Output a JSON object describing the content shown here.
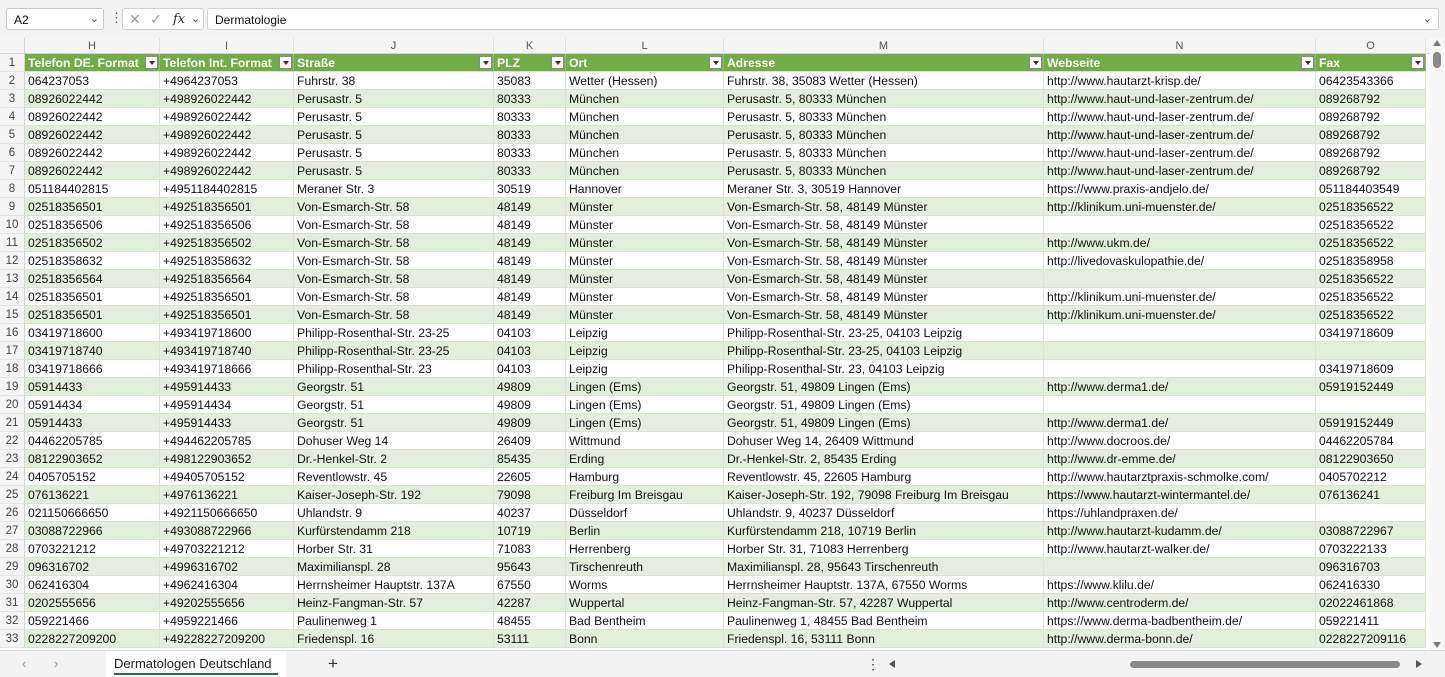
{
  "formula_bar": {
    "name_box": "A2",
    "more_glyph": "⋮",
    "cancel_glyph": "✕",
    "enter_glyph": "✓",
    "fx_glyph": "fx",
    "chevron_glyph": "⌄",
    "content": "Dermatologie"
  },
  "columns": [
    "H",
    "I",
    "J",
    "K",
    "L",
    "M",
    "N",
    "O"
  ],
  "header_row": {
    "number": "1",
    "cells": [
      "Telefon DE. Format",
      "Telefon Int. Format",
      "Straße",
      "PLZ",
      "Ort",
      "Adresse",
      "Webseite",
      "Fax"
    ]
  },
  "rows": [
    {
      "n": "2",
      "cells": [
        "064237053",
        "+4964237053",
        "Fuhrstr. 38",
        "35083",
        "Wetter (Hessen)",
        "Fuhrstr. 38, 35083 Wetter (Hessen)",
        "http://www.hautarzt-krisp.de/",
        "06423543366"
      ]
    },
    {
      "n": "3",
      "cells": [
        "08926022442",
        "+498926022442",
        "Perusastr. 5",
        "80333",
        "München",
        "Perusastr. 5, 80333 München",
        "http://www.haut-und-laser-zentrum.de/",
        "089268792"
      ]
    },
    {
      "n": "4",
      "cells": [
        "08926022442",
        "+498926022442",
        "Perusastr. 5",
        "80333",
        "München",
        "Perusastr. 5, 80333 München",
        "http://www.haut-und-laser-zentrum.de/",
        "089268792"
      ]
    },
    {
      "n": "5",
      "cells": [
        "08926022442",
        "+498926022442",
        "Perusastr. 5",
        "80333",
        "München",
        "Perusastr. 5, 80333 München",
        "http://www.haut-und-laser-zentrum.de/",
        "089268792"
      ]
    },
    {
      "n": "6",
      "cells": [
        "08926022442",
        "+498926022442",
        "Perusastr. 5",
        "80333",
        "München",
        "Perusastr. 5, 80333 München",
        "http://www.haut-und-laser-zentrum.de/",
        "089268792"
      ]
    },
    {
      "n": "7",
      "cells": [
        "08926022442",
        "+498926022442",
        "Perusastr. 5",
        "80333",
        "München",
        "Perusastr. 5, 80333 München",
        "http://www.haut-und-laser-zentrum.de/",
        "089268792"
      ]
    },
    {
      "n": "8",
      "cells": [
        "051184402815",
        "+4951184402815",
        "Meraner Str. 3",
        "30519",
        "Hannover",
        "Meraner Str. 3, 30519 Hannover",
        "https://www.praxis-andjelo.de/",
        "051184403549"
      ]
    },
    {
      "n": "9",
      "cells": [
        "02518356501",
        "+492518356501",
        "Von-Esmarch-Str. 58",
        "48149",
        "Münster",
        "Von-Esmarch-Str. 58, 48149 Münster",
        "http://klinikum.uni-muenster.de/",
        "02518356522"
      ]
    },
    {
      "n": "10",
      "cells": [
        "02518356506",
        "+492518356506",
        "Von-Esmarch-Str. 58",
        "48149",
        "Münster",
        "Von-Esmarch-Str. 58, 48149 Münster",
        "",
        "02518356522"
      ]
    },
    {
      "n": "11",
      "cells": [
        "02518356502",
        "+492518356502",
        "Von-Esmarch-Str. 58",
        "48149",
        "Münster",
        "Von-Esmarch-Str. 58, 48149 Münster",
        "http://www.ukm.de/",
        "02518356522"
      ]
    },
    {
      "n": "12",
      "cells": [
        "02518358632",
        "+492518358632",
        "Von-Esmarch-Str. 58",
        "48149",
        "Münster",
        "Von-Esmarch-Str. 58, 48149 Münster",
        "http://livedovaskulopathie.de/",
        "02518358958"
      ]
    },
    {
      "n": "13",
      "cells": [
        "02518356564",
        "+492518356564",
        "Von-Esmarch-Str. 58",
        "48149",
        "Münster",
        "Von-Esmarch-Str. 58, 48149 Münster",
        "",
        "02518356522"
      ]
    },
    {
      "n": "14",
      "cells": [
        "02518356501",
        "+492518356501",
        "Von-Esmarch-Str. 58",
        "48149",
        "Münster",
        "Von-Esmarch-Str. 58, 48149 Münster",
        "http://klinikum.uni-muenster.de/",
        "02518356522"
      ]
    },
    {
      "n": "15",
      "cells": [
        "02518356501",
        "+492518356501",
        "Von-Esmarch-Str. 58",
        "48149",
        "Münster",
        "Von-Esmarch-Str. 58, 48149 Münster",
        "http://klinikum.uni-muenster.de/",
        "02518356522"
      ]
    },
    {
      "n": "16",
      "cells": [
        "03419718600",
        "+493419718600",
        "Philipp-Rosenthal-Str. 23-25",
        "04103",
        "Leipzig",
        "Philipp-Rosenthal-Str. 23-25, 04103 Leipzig",
        "",
        "03419718609"
      ]
    },
    {
      "n": "17",
      "cells": [
        "03419718740",
        "+493419718740",
        "Philipp-Rosenthal-Str. 23-25",
        "04103",
        "Leipzig",
        "Philipp-Rosenthal-Str. 23-25, 04103 Leipzig",
        "",
        ""
      ]
    },
    {
      "n": "18",
      "cells": [
        "03419718666",
        "+493419718666",
        "Philipp-Rosenthal-Str. 23",
        "04103",
        "Leipzig",
        "Philipp-Rosenthal-Str. 23, 04103 Leipzig",
        "",
        "03419718609"
      ]
    },
    {
      "n": "19",
      "cells": [
        "05914433",
        "+495914433",
        "Georgstr. 51",
        "49809",
        "Lingen (Ems)",
        "Georgstr. 51, 49809 Lingen (Ems)",
        "http://www.derma1.de/",
        "05919152449"
      ]
    },
    {
      "n": "20",
      "cells": [
        "05914434",
        "+495914434",
        "Georgstr. 51",
        "49809",
        "Lingen (Ems)",
        "Georgstr. 51, 49809 Lingen (Ems)",
        "",
        ""
      ]
    },
    {
      "n": "21",
      "cells": [
        "05914433",
        "+495914433",
        "Georgstr. 51",
        "49809",
        "Lingen (Ems)",
        "Georgstr. 51, 49809 Lingen (Ems)",
        "http://www.derma1.de/",
        "05919152449"
      ]
    },
    {
      "n": "22",
      "cells": [
        "04462205785",
        "+494462205785",
        "Dohuser Weg 14",
        "26409",
        "Wittmund",
        "Dohuser Weg 14, 26409 Wittmund",
        "http://www.docroos.de/",
        "04462205784"
      ]
    },
    {
      "n": "23",
      "cells": [
        "08122903652",
        "+498122903652",
        "Dr.-Henkel-Str. 2",
        "85435",
        "Erding",
        "Dr.-Henkel-Str. 2, 85435 Erding",
        "http://www.dr-emme.de/",
        "08122903650"
      ]
    },
    {
      "n": "24",
      "cells": [
        "0405705152",
        "+49405705152",
        "Reventlowstr. 45",
        "22605",
        "Hamburg",
        "Reventlowstr. 45, 22605 Hamburg",
        "http://www.hautarztpraxis-schmolke.com/",
        "0405702212"
      ]
    },
    {
      "n": "25",
      "cells": [
        "076136221",
        "+4976136221",
        "Kaiser-Joseph-Str. 192",
        "79098",
        "Freiburg Im Breisgau",
        "Kaiser-Joseph-Str. 192, 79098 Freiburg Im Breisgau",
        "https://www.hautarzt-wintermantel.de/",
        "076136241"
      ]
    },
    {
      "n": "26",
      "cells": [
        "021150666650",
        "+4921150666650",
        "Uhlandstr. 9",
        "40237",
        "Düsseldorf",
        "Uhlandstr. 9, 40237 Düsseldorf",
        "https://uhlandpraxen.de/",
        ""
      ]
    },
    {
      "n": "27",
      "cells": [
        "03088722966",
        "+493088722966",
        "Kurfürstendamm 218",
        "10719",
        "Berlin",
        "Kurfürstendamm 218, 10719 Berlin",
        "http://www.hautarzt-kudamm.de/",
        "03088722967"
      ]
    },
    {
      "n": "28",
      "cells": [
        "0703221212",
        "+49703221212",
        "Horber Str. 31",
        "71083",
        "Herrenberg",
        "Horber Str. 31, 71083 Herrenberg",
        "http://www.hautarzt-walker.de/",
        "0703222133"
      ]
    },
    {
      "n": "29",
      "cells": [
        "096316702",
        "+4996316702",
        "Maximilianspl. 28",
        "95643",
        "Tirschenreuth",
        "Maximilianspl. 28, 95643 Tirschenreuth",
        "",
        "096316703"
      ]
    },
    {
      "n": "30",
      "cells": [
        "062416304",
        "+4962416304",
        "Herrnsheimer Hauptstr. 137A",
        "67550",
        "Worms",
        "Herrnsheimer Hauptstr. 137A, 67550 Worms",
        "https://www.klilu.de/",
        "062416330"
      ]
    },
    {
      "n": "31",
      "cells": [
        "0202555656",
        "+49202555656",
        "Heinz-Fangman-Str. 57",
        "42287",
        "Wuppertal",
        "Heinz-Fangman-Str. 57, 42287 Wuppertal",
        "http://www.centroderm.de/",
        "02022461868"
      ]
    },
    {
      "n": "32",
      "cells": [
        "059221466",
        "+4959221466",
        "Paulinenweg 1",
        "48455",
        "Bad Bentheim",
        "Paulinenweg 1, 48455 Bad Bentheim",
        "https://www.derma-badbentheim.de/",
        "059221411"
      ]
    },
    {
      "n": "33",
      "cells": [
        "0228227209200",
        "+49228227209200",
        "Friedenspl. 16",
        "53111",
        "Bonn",
        "Friedenspl. 16, 53111 Bonn",
        "http://www.derma-bonn.de/",
        "0228227209116"
      ]
    }
  ],
  "sheet_tabs": {
    "prev_glyph": "‹",
    "next_glyph": "›",
    "active": "Dermatologen Deutschland",
    "add_glyph": "+",
    "more_glyph": "⋮"
  },
  "colors": {
    "header_fill": "#70ad47",
    "band_fill": "#e2efda",
    "header_text": "#ffffff"
  }
}
